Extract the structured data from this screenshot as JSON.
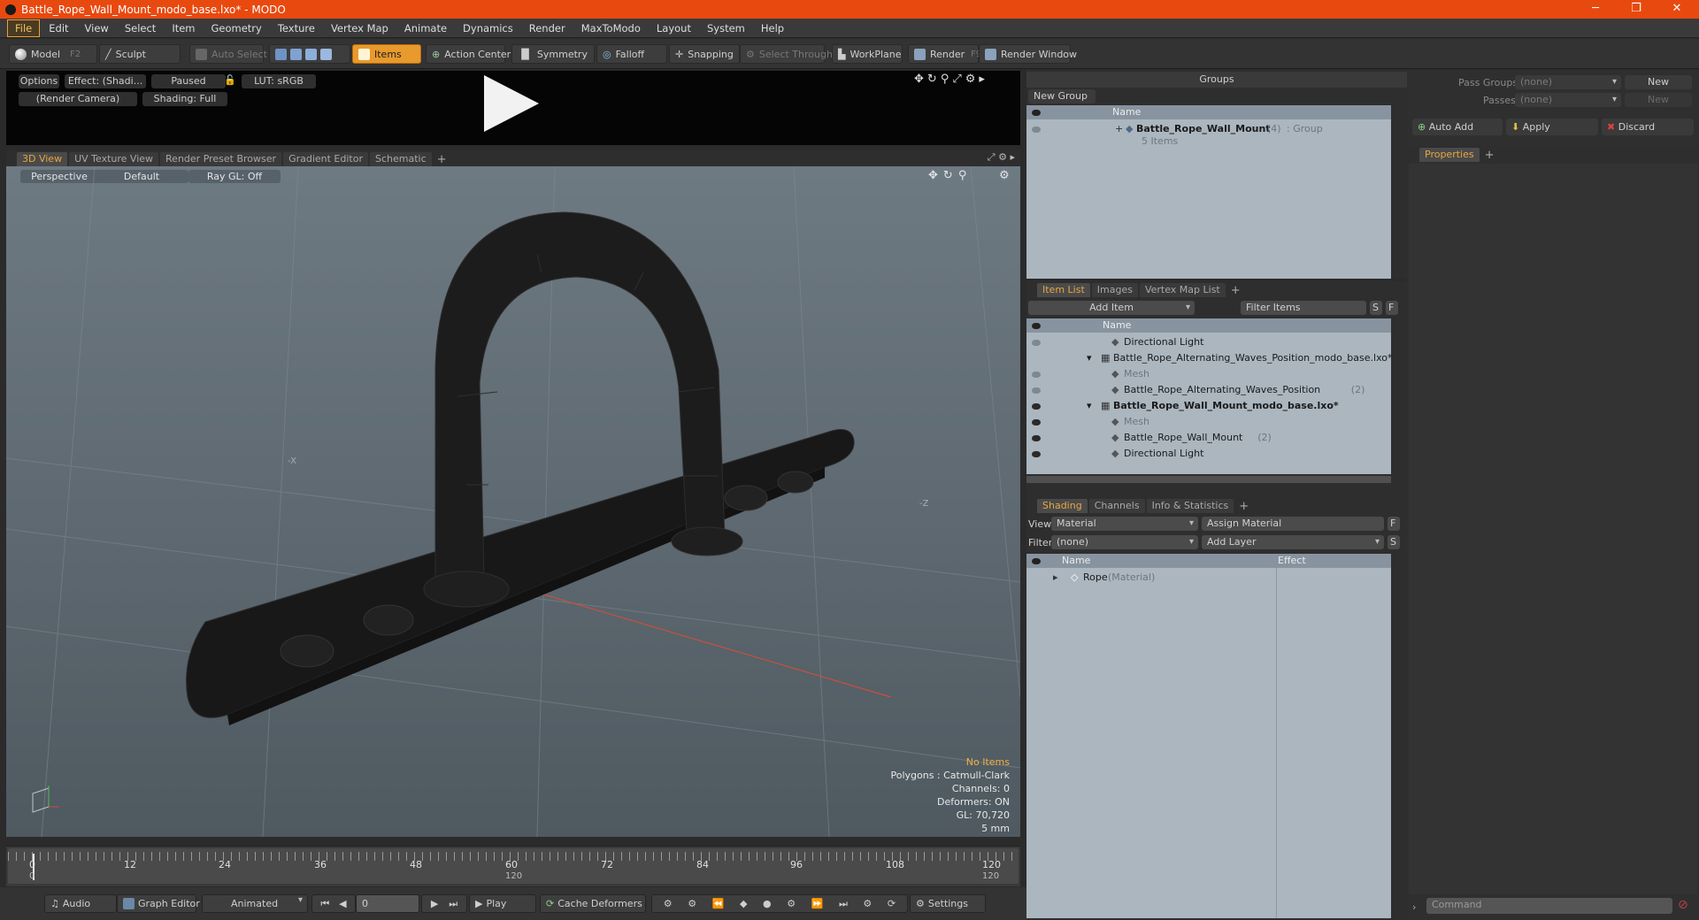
{
  "window": {
    "title": "Battle_Rope_Wall_Mount_modo_base.lxo* - MODO",
    "minimize": "─",
    "maximize": "❐",
    "close": "✕"
  },
  "menu": [
    "File",
    "Edit",
    "View",
    "Select",
    "Item",
    "Geometry",
    "Texture",
    "Vertex Map",
    "Animate",
    "Dynamics",
    "Render",
    "MaxToModo",
    "Layout",
    "System",
    "Help"
  ],
  "toolbar": {
    "model": "Model",
    "model_key": "F2",
    "sculpt": "Sculpt",
    "auto_select": "Auto Select",
    "items": "Items",
    "action_center": "Action Center",
    "symmetry": "Symmetry",
    "falloff": "Falloff",
    "snapping": "Snapping",
    "select_through": "Select Through",
    "workplane": "WorkPlane",
    "render": "Render",
    "render_key": "F9",
    "render_window": "Render Window"
  },
  "render_preview": {
    "options": "Options",
    "effect": "Effect: (Shadi...",
    "paused": "Paused",
    "lut": "LUT: sRGB",
    "camera": "(Render Camera)",
    "shading": "Shading: Full"
  },
  "view_tabs": [
    "3D View",
    "UV Texture View",
    "Render Preset Browser",
    "Gradient Editor",
    "Schematic"
  ],
  "viewport": {
    "perspective": "Perspective",
    "default": "Default",
    "raygl": "Ray GL: Off",
    "axis_x": "-X",
    "axis_z": "-Z",
    "hud": {
      "selection": "No Items",
      "polygons": "Polygons : Catmull-Clark",
      "channels": "Channels: 0",
      "deformers": "Deformers: ON",
      "gl": "GL: 70,720",
      "scale": "5 mm"
    },
    "selection_color": "#f0b040",
    "wire_color": "#1a1a1a"
  },
  "timeline": {
    "ticks": [
      "0",
      "12",
      "24",
      "36",
      "48",
      "60",
      "72",
      "84",
      "96",
      "108",
      "120"
    ],
    "lower": [
      "0",
      "120",
      "120"
    ]
  },
  "bottom": {
    "audio": "Audio",
    "graph_editor": "Graph Editor",
    "animated": "Animated",
    "frame": "0",
    "play": "Play",
    "cache_deformers": "Cache Deformers",
    "settings": "Settings"
  },
  "groups": {
    "title": "Groups",
    "new_group": "New Group",
    "col_name": "Name",
    "item": "Battle_Rope_Wall_Mount",
    "item_count": "(4)",
    "item_type": ": Group",
    "item_sub": "5 Items"
  },
  "item_list": {
    "tabs": [
      "Item List",
      "Images",
      "Vertex Map List"
    ],
    "add_item": "Add Item",
    "filter": "Filter Items",
    "s": "S",
    "f": "F",
    "col_name": "Name",
    "rows": [
      {
        "label": "Directional Light",
        "extra": "",
        "indent": 1,
        "eye": "off",
        "style": ""
      },
      {
        "label": "Battle_Rope_Alternating_Waves_Position_modo_base.lxo*",
        "extra": "",
        "indent": 0,
        "eye": "none",
        "style": ""
      },
      {
        "label": "Mesh",
        "extra": "",
        "indent": 1,
        "eye": "off",
        "style": "gray"
      },
      {
        "label": "Battle_Rope_Alternating_Waves_Position",
        "extra": "(2)",
        "indent": 1,
        "eye": "off",
        "style": ""
      },
      {
        "label": "Battle_Rope_Wall_Mount_modo_base.lxo*",
        "extra": "",
        "indent": 0,
        "eye": "on",
        "style": "bold"
      },
      {
        "label": "Mesh",
        "extra": "",
        "indent": 1,
        "eye": "on",
        "style": "gray"
      },
      {
        "label": "Battle_Rope_Wall_Mount",
        "extra": "(2)",
        "indent": 1,
        "eye": "on",
        "style": ""
      },
      {
        "label": "Directional Light",
        "extra": "",
        "indent": 1,
        "eye": "on",
        "style": ""
      }
    ]
  },
  "shading": {
    "tabs": [
      "Shading",
      "Channels",
      "Info & Statistics"
    ],
    "view_label": "View",
    "view_value": "Material",
    "assign": "Assign Material",
    "filter_label": "Filter",
    "filter_value": "(none)",
    "add_layer": "Add Layer",
    "f": "F",
    "s": "S",
    "col_name": "Name",
    "col_effect": "Effect",
    "row": "Rope",
    "row_type": "(Material)"
  },
  "passes": {
    "pass_groups": "Pass Groups",
    "passes": "Passes",
    "none": "(none)",
    "new": "New",
    "auto_add": "Auto Add",
    "apply": "Apply",
    "discard": "Discard",
    "properties": "Properties"
  },
  "command": {
    "placeholder": "Command"
  }
}
